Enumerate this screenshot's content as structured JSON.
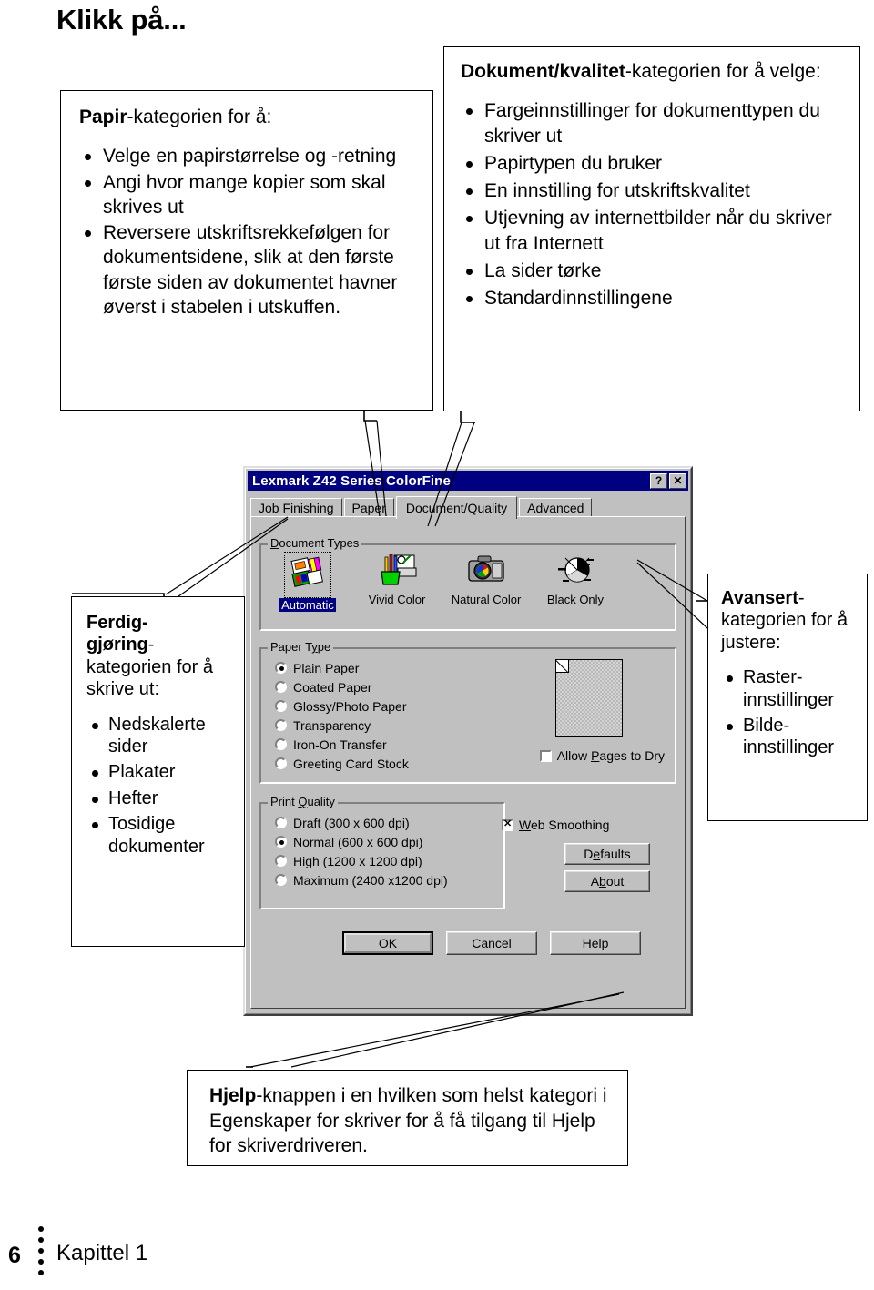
{
  "heading": "Klikk på...",
  "callouts": {
    "papir": {
      "lead_bold": "Papir",
      "lead_rest": "-kategorien for å:",
      "items": [
        "Velge en papirstørrelse og -retning",
        "Angi hvor mange kopier som skal skrives ut",
        "Reversere utskriftsrekkefølgen for dokumentsidene, slik at den første første siden av dokumentet havner øverst i stabelen i utskuffen."
      ]
    },
    "dokument_kvalitet": {
      "lead_bold": "Dokument/kvalitet",
      "lead_rest": "-kategorien for å velge:",
      "items": [
        "Fargeinnstillinger for dokumenttypen du skriver ut",
        "Papirtypen du bruker",
        "En innstilling for utskriftskvalitet",
        "Utjevning av internettbilder når du skriver ut fra Internett",
        "La sider tørke",
        "Standardinnstillingene"
      ]
    },
    "ferdiggjoring": {
      "lead_bold": "Ferdig-\ngjøring",
      "lead_rest": "-kategorien for å skrive ut:",
      "items": [
        "Nedskalerte sider",
        "Plakater",
        "Hefter",
        "Tosidige dokumenter"
      ]
    },
    "avansert": {
      "lead_bold": "Avansert",
      "lead_rest": "-kategorien for å justere:",
      "items": [
        "Raster-innstillinger",
        "Bilde-innstillinger"
      ]
    },
    "hjelp": {
      "lead_bold": "Hjelp",
      "lead_rest": "-knappen i en hvilken som helst kategori i Egenskaper for skriver for å få tilgang til Hjelp for skriverdriveren."
    }
  },
  "dialog": {
    "title": "Lexmark Z42 Series ColorFine",
    "titlebar_buttons": {
      "help": "?",
      "close": "✕"
    },
    "tabs": [
      {
        "label": "Job Finishing",
        "active": false
      },
      {
        "label": "Paper",
        "active": false
      },
      {
        "label": "Document/Quality",
        "active": true
      },
      {
        "label": "Advanced",
        "active": false
      }
    ],
    "document_types": {
      "group_label": "Document Types",
      "items": [
        {
          "label": "Automatic",
          "selected": true,
          "icon": "automatic-palette-icon"
        },
        {
          "label": "Vivid Color",
          "selected": false,
          "icon": "pencil-cup-icon"
        },
        {
          "label": "Natural Color",
          "selected": false,
          "icon": "camera-icon"
        },
        {
          "label": "Black Only",
          "selected": false,
          "icon": "black-pie-icon"
        }
      ]
    },
    "paper_type": {
      "group_label": "Paper Type",
      "options": [
        {
          "label": "Plain Paper",
          "selected": true
        },
        {
          "label": "Coated Paper",
          "selected": false
        },
        {
          "label": "Glossy/Photo Paper",
          "selected": false
        },
        {
          "label": "Transparency",
          "selected": false
        },
        {
          "label": "Iron-On Transfer",
          "selected": false
        },
        {
          "label": "Greeting Card Stock",
          "selected": false
        }
      ],
      "allow_pages_to_dry": {
        "label": "Allow Pages to Dry",
        "checked": false
      }
    },
    "print_quality": {
      "group_label": "Print Quality",
      "options": [
        {
          "label": "Draft (300 x 600 dpi)",
          "selected": false
        },
        {
          "label": "Normal (600 x 600 dpi)",
          "selected": true
        },
        {
          "label": "High (1200 x 1200 dpi)",
          "selected": false
        },
        {
          "label": "Maximum (2400 x1200 dpi)",
          "selected": false
        }
      ]
    },
    "web_smoothing": {
      "label": "Web Smoothing",
      "checked": true
    },
    "buttons": {
      "defaults": "Defaults",
      "about": "About",
      "ok": "OK",
      "cancel": "Cancel",
      "help": "Help"
    }
  },
  "footer": {
    "page_number": "6",
    "chapter": "Kapittel 1"
  },
  "colors": {
    "titlebar": "#000080",
    "dialog_face": "#c0c0c0",
    "selection": "#000080",
    "text": "#000000"
  }
}
